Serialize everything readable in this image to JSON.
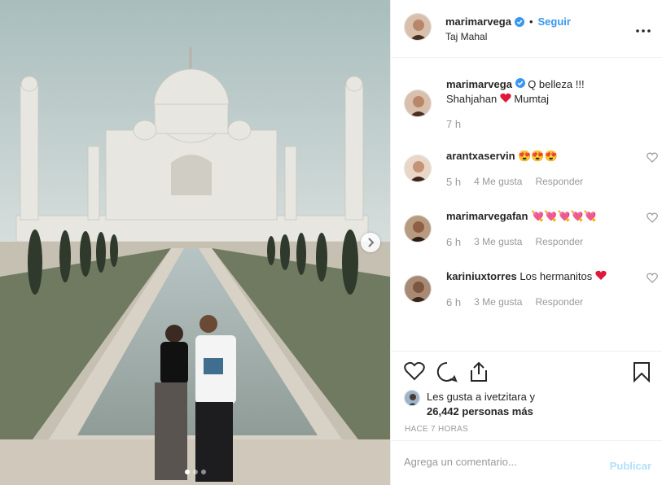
{
  "post": {
    "author": "marimarvega",
    "follow_label": "Seguir",
    "separator": "•",
    "location": "Taj Mahal",
    "more_icon": "more-horizontal-icon",
    "photo_indicator": {
      "count": 3,
      "active": 1
    }
  },
  "caption": {
    "user": "marimarvega",
    "text_line1": "Q belleza !!!",
    "text_line2_a": "Shahjahan",
    "text_line2_b": "Mumtaj",
    "time": "7 h"
  },
  "comments": [
    {
      "user": "arantxaservin",
      "text": "😍😍😍",
      "time": "5 h",
      "likes": "4 Me gusta",
      "reply": "Responder"
    },
    {
      "user": "marimarvegafan",
      "text": "💘💘💘💘💘",
      "time": "6 h",
      "likes": "3 Me gusta",
      "reply": "Responder"
    },
    {
      "user": "kariniuxtorres",
      "text": "Los hermanitos",
      "time": "6 h",
      "likes": "3 Me gusta",
      "reply": "Responder"
    }
  ],
  "likes": {
    "line1": "Les gusta a ivetzitara y",
    "line2": "26,442 personas más"
  },
  "timestamp": "HACE 7 HORAS",
  "add_comment": {
    "placeholder": "Agrega un comentario...",
    "publish_label": "Publicar"
  },
  "colors": {
    "link_blue": "#3897f0",
    "publish_disabled": "#b2dffc",
    "heart_red": "#ed4956",
    "muted": "#999999"
  }
}
